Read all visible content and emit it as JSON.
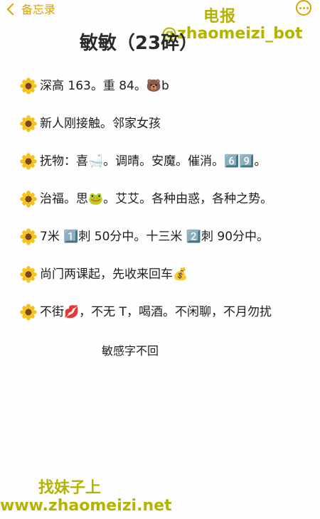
{
  "nav": {
    "back_label": "备忘录"
  },
  "watermark": {
    "top_line1": "电报",
    "top_line2": "@zhaomeizi_bot",
    "bottom_line1": "找妹子上",
    "bottom_line2": "www.zhaomeizi.net"
  },
  "title": "敏敏（23碎）",
  "lines": [
    " 深高 163。重 84。🐻b",
    "新人刚接触。邻家女孩",
    "抚物：喜🛁。调晴。安魔。催消。6️⃣9️⃣。",
    "治福。思🐸。艾艾。各种由惑，各种之势。",
    " 7米 1️⃣刺 50分中。十三米 2️⃣刺 90分中。",
    "尚门两课起，先收来回车💰",
    "不街💋，不无 T，喝酒。不闲聊，不月勿扰"
  ],
  "footer_note": "敏感字不回",
  "colors": {
    "accent": "#d6a400",
    "watermark": "#b4b300"
  },
  "icons": [
    "chevron-left-icon",
    "more-icon",
    "sunflower-icon"
  ]
}
